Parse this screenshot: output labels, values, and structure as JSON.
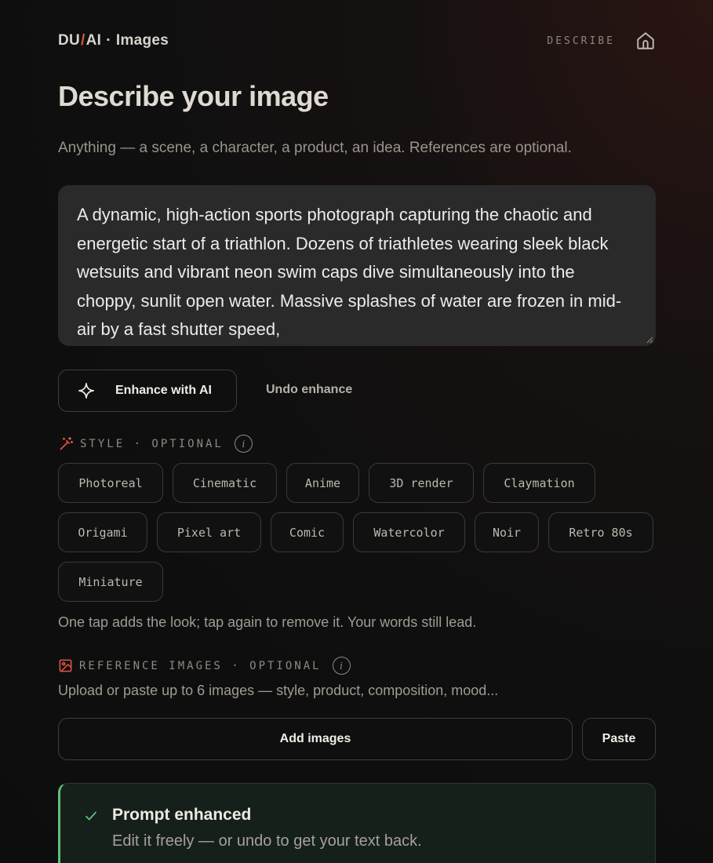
{
  "header": {
    "brand_du": "DU",
    "brand_slash": "/",
    "brand_ai": "AI",
    "brand_dot": "·",
    "brand_sub": "Images",
    "describe_link": "DESCRIBE",
    "home_icon": "home-icon"
  },
  "page": {
    "title": "Describe your image",
    "subtitle": "Anything — a scene, a character, a product, an idea. References are optional."
  },
  "prompt": {
    "value": "A dynamic, high-action sports photograph capturing the chaotic and energetic start of a triathlon. Dozens of triathletes wearing sleek black wetsuits and vibrant neon swim caps dive simultaneously into the choppy, sunlit open water. Massive splashes of water are frozen in mid-air by a fast shutter speed,"
  },
  "actions": {
    "enhance_label": "Enhance with AI",
    "undo_label": "Undo enhance",
    "enhance_icon": "sparkle-icon"
  },
  "style": {
    "label": "STYLE · OPTIONAL",
    "icon": "magic-wand-icon",
    "info": "i",
    "chips": [
      "Photoreal",
      "Cinematic",
      "Anime",
      "3D render",
      "Claymation",
      "Origami",
      "Pixel art",
      "Comic",
      "Watercolor",
      "Noir",
      "Retro 80s",
      "Miniature"
    ],
    "hint": "One tap adds the look; tap again to remove it. Your words still lead."
  },
  "references": {
    "label": "REFERENCE IMAGES · OPTIONAL",
    "icon": "image-icon",
    "info": "i",
    "hint": "Upload or paste up to 6 images — style, product, composition, mood...",
    "add_label": "Add images",
    "paste_label": "Paste"
  },
  "toast": {
    "title": "Prompt enhanced",
    "body": "Edit it freely — or undo to get your text back.",
    "icon": "check-icon"
  },
  "colors": {
    "accent": "#e0573e",
    "success": "#5fbf7a"
  }
}
